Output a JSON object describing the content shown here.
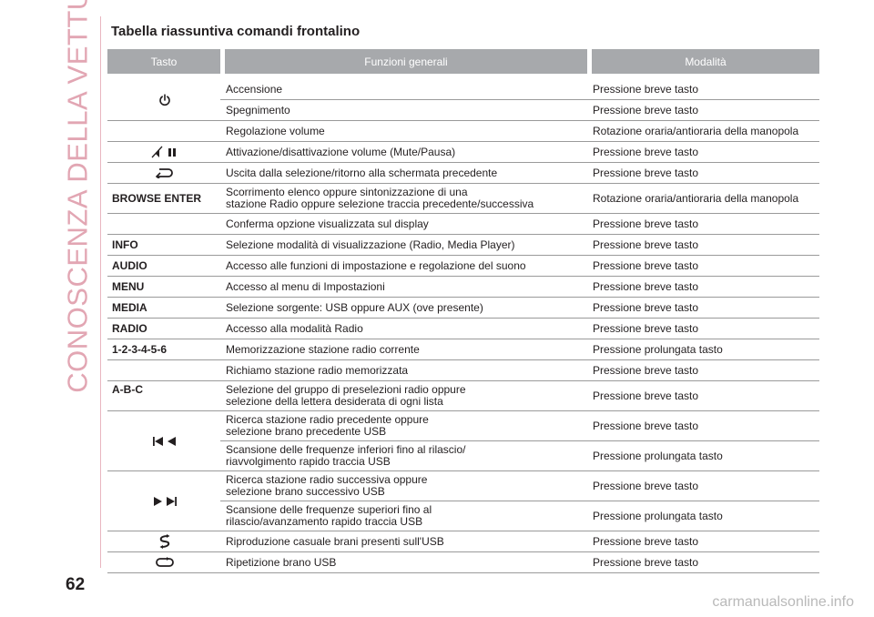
{
  "sidebar_title": "CONOSCENZA DELLA VETTURA",
  "page_number": "62",
  "title": "Tabella riassuntiva comandi frontalino",
  "watermark": "carmanualsonline.info",
  "table": {
    "headers": [
      "Tasto",
      "Funzioni generali",
      "Modalità"
    ],
    "rows": {
      "power": {
        "key_icon": "power-icon",
        "items": [
          {
            "function": "Accensione",
            "mode": "Pressione breve tasto"
          },
          {
            "function": "Spegnimento",
            "mode": "Pressione breve tasto"
          },
          {
            "function": "Regolazione volume",
            "mode": "Rotazione oraria/antioraria della manopola"
          }
        ]
      },
      "mute": {
        "key_icon": "mute-pause-icon",
        "function": "Attivazione/disattivazione volume (Mute/Pausa)",
        "mode": "Pressione breve tasto"
      },
      "back": {
        "key_icon": "back-icon",
        "function": "Uscita dalla selezione/ritorno alla schermata precedente",
        "mode": "Pressione breve tasto"
      },
      "browse": {
        "key": "BROWSE ENTER",
        "items": [
          {
            "function_line1": "Scorrimento elenco oppure sintonizzazione di una",
            "function_line2": "stazione Radio oppure selezione traccia precedente/successiva",
            "mode": "Rotazione oraria/antioraria della manopola"
          },
          {
            "function": "Conferma opzione visualizzata sul display",
            "mode": "Pressione breve tasto"
          }
        ]
      },
      "info": {
        "key": "INFO",
        "function": "Selezione modalità di visualizzazione (Radio, Media Player)",
        "mode": "Pressione breve tasto"
      },
      "audio": {
        "key": "AUDIO",
        "function": "Accesso alle funzioni di impostazione e regolazione del suono",
        "mode": "Pressione breve tasto"
      },
      "menu": {
        "key": "MENU",
        "function": "Accesso al menu di Impostazioni",
        "mode": "Pressione breve tasto"
      },
      "media": {
        "key": "MEDIA",
        "function": "Selezione sorgente: USB oppure AUX (ove presente)",
        "mode": "Pressione breve tasto"
      },
      "radio": {
        "key": "RADIO",
        "function": "Accesso alla modalità Radio",
        "mode": "Pressione breve tasto"
      },
      "presets": {
        "key": "1-2-3-4-5-6",
        "items": [
          {
            "function": "Memorizzazione stazione radio corrente",
            "mode": "Pressione prolungata tasto"
          },
          {
            "function": "Richiamo stazione radio memorizzata",
            "mode": "Pressione breve tasto"
          }
        ]
      },
      "abc": {
        "key": "A-B-C",
        "function_line1": "Selezione del gruppo di preselezioni radio oppure",
        "function_line2": "selezione della lettera desiderata di ogni lista",
        "mode": "Pressione breve tasto"
      },
      "prev": {
        "key_icon": "skip-previous-icon",
        "items": [
          {
            "function_line1": "Ricerca stazione radio precedente oppure",
            "function_line2": "selezione brano precedente USB",
            "mode": "Pressione breve tasto"
          },
          {
            "function_line1": "Scansione delle frequenze inferiori fino al rilascio/",
            "function_line2": "riavvolgimento rapido traccia USB",
            "mode": "Pressione prolungata tasto"
          }
        ]
      },
      "next": {
        "key_icon": "skip-next-icon",
        "items": [
          {
            "function_line1": "Ricerca stazione radio successiva oppure",
            "function_line2": "selezione brano successivo USB",
            "mode": "Pressione breve tasto"
          },
          {
            "function_line1": "Scansione delle frequenze superiori fino al",
            "function_line2": "rilascio/avanzamento rapido traccia USB",
            "mode": "Pressione prolungata tasto"
          }
        ]
      },
      "shuffle": {
        "key_icon": "shuffle-icon",
        "function": "Riproduzione casuale brani presenti sull'USB",
        "mode": "Pressione breve tasto"
      },
      "repeat": {
        "key_icon": "repeat-icon",
        "function": "Ripetizione brano USB",
        "mode": "Pressione breve tasto"
      }
    }
  },
  "colors": {
    "header_bg": "#a7a9ac",
    "accent_pink": "#e2a6b3",
    "text": "#231f20",
    "rule": "#9a9a9a"
  }
}
